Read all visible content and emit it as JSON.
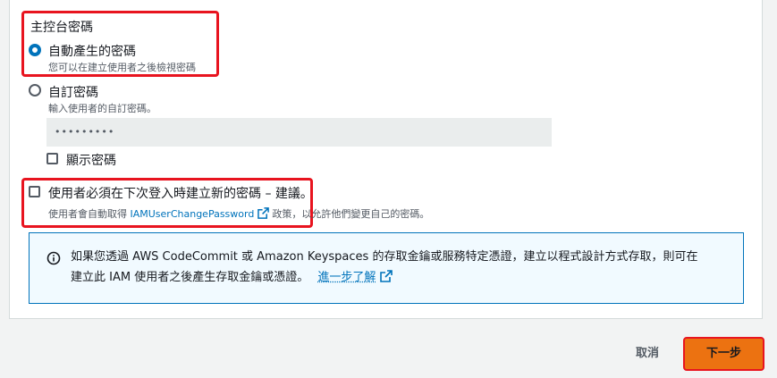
{
  "console_password": {
    "section_label": "主控台密碼",
    "options": [
      {
        "label": "自動產生的密碼",
        "description": "您可以在建立使用者之後檢視密碼",
        "selected": true
      },
      {
        "label": "自訂密碼",
        "description": "輸入使用者的自訂密碼。",
        "selected": false
      }
    ],
    "password_value": "•••••••••",
    "show_password_label": "顯示密碼"
  },
  "reset_required": {
    "label": "使用者必須在下次登入時建立新的密碼 – 建議。",
    "desc_prefix": "使用者會自動取得",
    "policy_link": "IAMUserChangePassword",
    "desc_suffix": "政策，以允許他們變更自己的密碼。"
  },
  "info": {
    "line1": "如果您透過 AWS CodeCommit 或 Amazon Keyspaces 的存取金鑰或服務特定憑證，建立以程式設計方式存取，則可在",
    "line2_prefix": "建立此 IAM 使用者之後產生存取金鑰或憑證。",
    "learn_more": "進一步了解"
  },
  "footer": {
    "cancel_label": "取消",
    "next_label": "下一步"
  },
  "colors": {
    "accent": "#0073bb",
    "primary_button": "#ec7211",
    "highlight_box": "#e8141f"
  }
}
